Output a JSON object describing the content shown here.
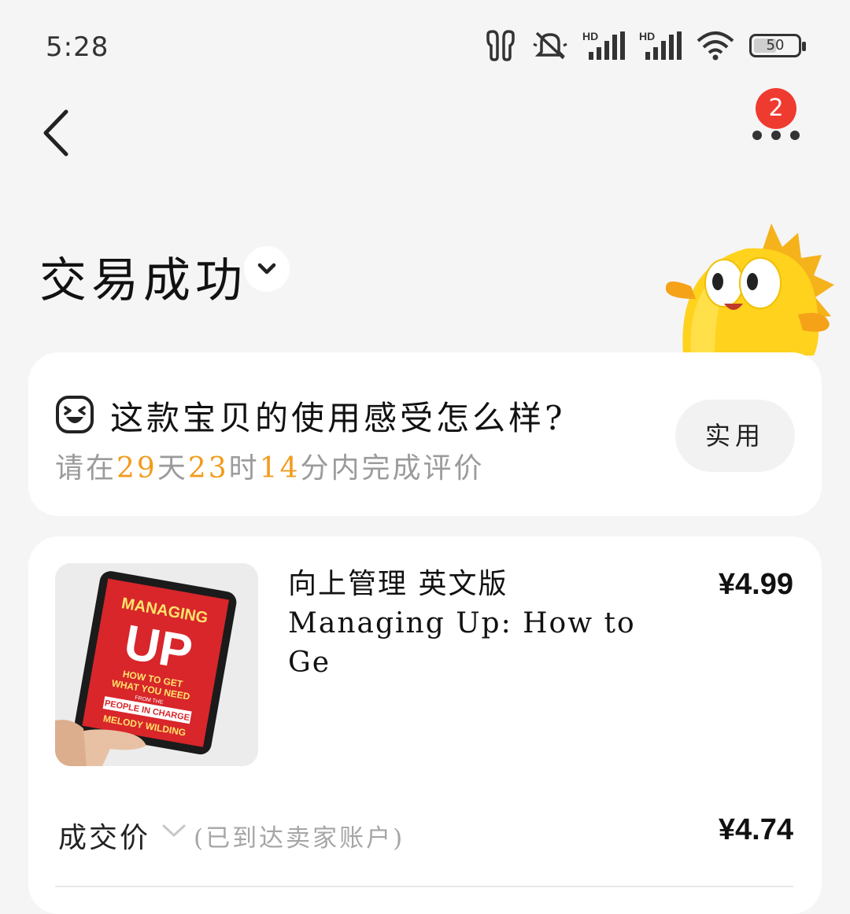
{
  "status_bar": {
    "time": "5:28",
    "battery_level": "50",
    "network_1": "HD",
    "network_2": "HD",
    "icons": [
      "earbuds-icon",
      "mute-icon",
      "signal-icon",
      "signal-icon",
      "wifi-icon",
      "battery-icon"
    ]
  },
  "nav": {
    "notification_count": "2",
    "icons": [
      "back-arrow-icon",
      "more-icon"
    ]
  },
  "order": {
    "status": "交易成功",
    "toggle_icon": "chevron-down-icon"
  },
  "review": {
    "question": "这款宝贝的使用感受怎么样?",
    "deadline_prefix": "请在",
    "days": "29",
    "days_unit": "天",
    "hours": "23",
    "hours_unit": "时",
    "minutes": "14",
    "minutes_suffix": "分内完成评价",
    "chip_label": "实用",
    "icon": "laughing-face-icon"
  },
  "product": {
    "title": "向上管理 英文版Managing Up: How to Ge",
    "price": "¥4.99",
    "deal_label": "成交价",
    "deal_note": "(已到达卖家账户)",
    "deal_price": "¥4.74",
    "image_text": {
      "line1": "MANAGING",
      "line2": "UP",
      "line3": "HOW TO GET",
      "line4": "WHAT YOU NEED",
      "line5": "FROM THE",
      "line6": "PEOPLE IN CHARGE",
      "line7": "MELODY WILDING"
    }
  },
  "colors": {
    "background": "#f5f5f5",
    "card": "#ffffff",
    "badge": "#ef3b2f",
    "countdown": "#f29b1c",
    "muted_text": "#9b9b9b"
  }
}
